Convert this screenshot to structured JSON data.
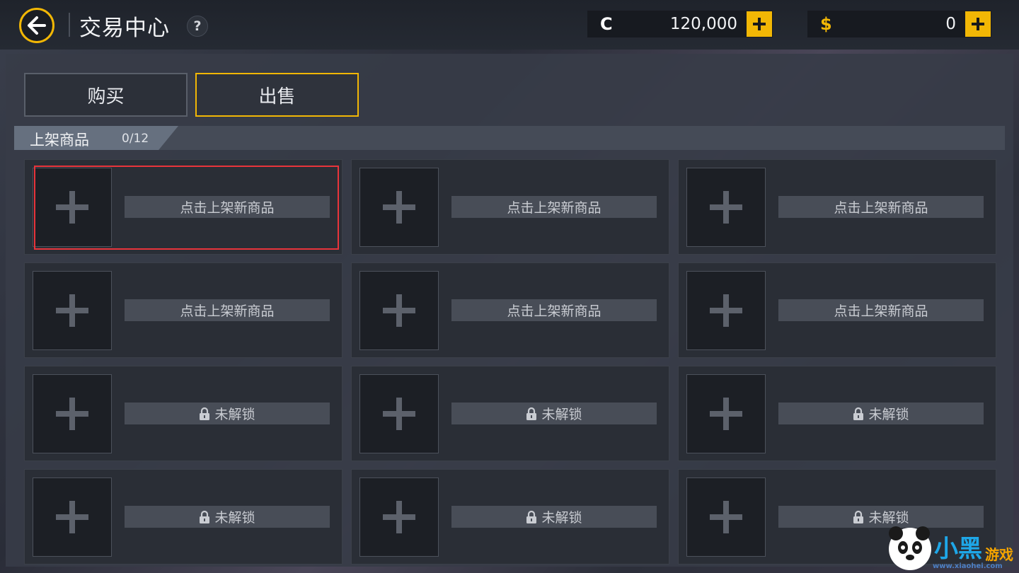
{
  "header": {
    "title": "交易中心",
    "help_label": "?"
  },
  "currencies": [
    {
      "symbol": "C",
      "value": "120,000",
      "add_label": "+"
    },
    {
      "symbol": "$",
      "value": "0",
      "add_label": "+"
    }
  ],
  "tabs": [
    {
      "label": "购买",
      "active": false
    },
    {
      "label": "出售",
      "active": true
    }
  ],
  "listing": {
    "title": "上架商品",
    "count": "0/12"
  },
  "slots": [
    {
      "label": "点击上架新商品",
      "locked": false
    },
    {
      "label": "点击上架新商品",
      "locked": false
    },
    {
      "label": "点击上架新商品",
      "locked": false
    },
    {
      "label": "点击上架新商品",
      "locked": false
    },
    {
      "label": "点击上架新商品",
      "locked": false
    },
    {
      "label": "点击上架新商品",
      "locked": false
    },
    {
      "label": "未解锁",
      "locked": true
    },
    {
      "label": "未解锁",
      "locked": true
    },
    {
      "label": "未解锁",
      "locked": true
    },
    {
      "label": "未解锁",
      "locked": true
    },
    {
      "label": "未解锁",
      "locked": true
    },
    {
      "label": "未解锁",
      "locked": true
    }
  ],
  "watermark": {
    "text_main": "小黑",
    "text_sub": "游戏",
    "url": "www.xiaohei.com"
  },
  "colors": {
    "accent": "#f2b705",
    "highlight": "#e8343b"
  },
  "icons": [
    "back-arrow-icon",
    "help-icon",
    "plus-icon",
    "lock-icon",
    "panda-logo-icon"
  ]
}
